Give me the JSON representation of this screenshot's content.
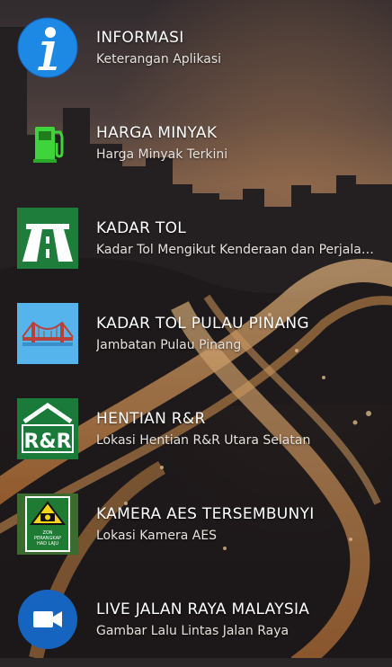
{
  "colors": {
    "info_blue": "#1e88e5",
    "toll_green": "#1e7d3a",
    "bridge_blue": "#56b4ec",
    "rr_green": "#1a7a3a",
    "video_blue": "#1565c0"
  },
  "items": [
    {
      "icon": "info-icon",
      "title": "INFORMASI",
      "subtitle": "Keterangan Aplikasi"
    },
    {
      "icon": "fuel-pump-icon",
      "title": "HARGA MINYAK",
      "subtitle": "Harga Minyak Terkini"
    },
    {
      "icon": "highway-toll-icon",
      "title": "KADAR TOL",
      "subtitle": "Kadar Tol Mengikut Kenderaan dan Perjalanan"
    },
    {
      "icon": "bridge-icon",
      "title": "KADAR TOL PULAU PINANG",
      "subtitle": "Jambatan Pulau Pinang"
    },
    {
      "icon": "rest-area-icon",
      "title": "HENTIAN R&R",
      "subtitle": "Lokasi Hentian R&R Utara Selatan"
    },
    {
      "icon": "speed-camera-sign-icon",
      "title": "KAMERA AES TERSEMBUNYI",
      "subtitle": "Lokasi Kamera AES"
    },
    {
      "icon": "video-camera-icon",
      "title": "LIVE JALAN RAYA MALAYSIA",
      "subtitle": "Gambar Lalu Lintas Jalan Raya"
    }
  ],
  "rr_label": "R&R",
  "sign_text_1": "ZON",
  "sign_text_2": "PERANGKAP",
  "sign_text_3": "HAD LAJU"
}
